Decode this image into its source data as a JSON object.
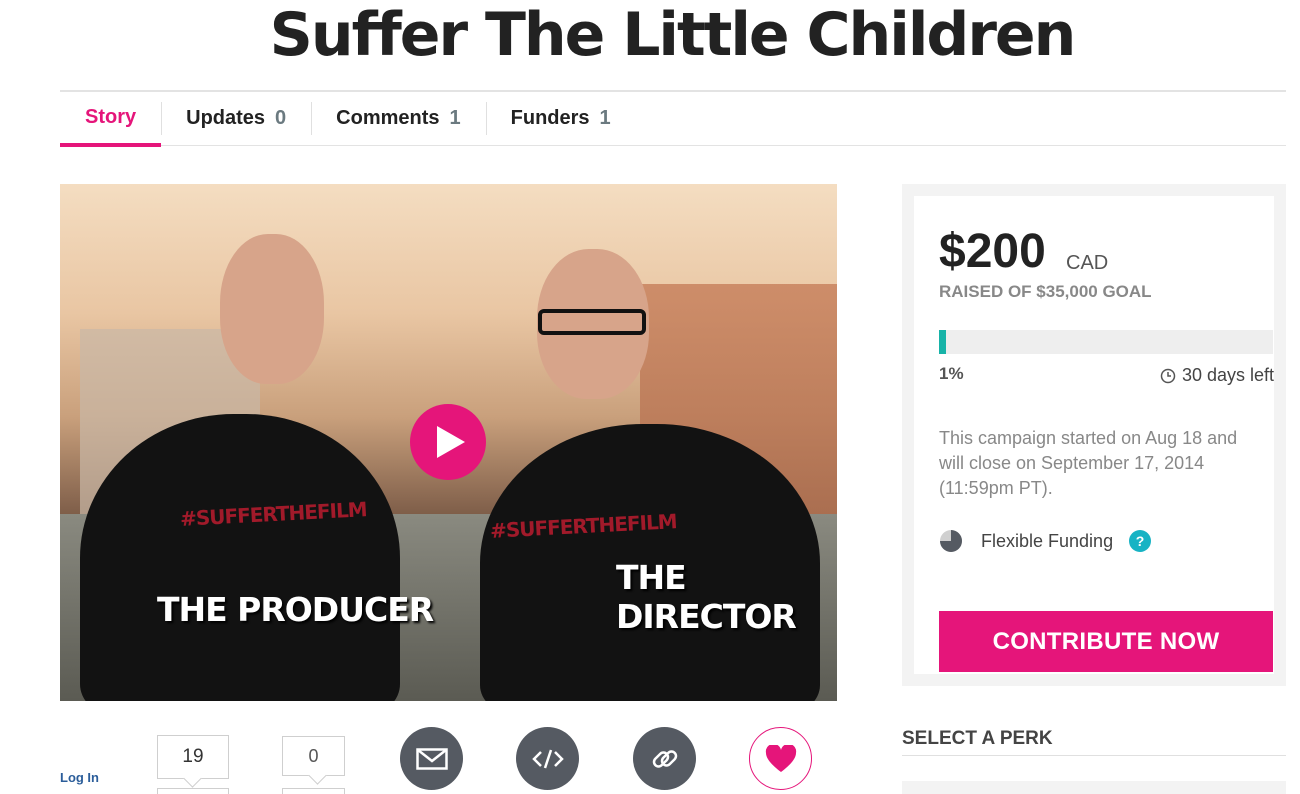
{
  "campaign": {
    "title": "Suffer The Little Children"
  },
  "tabs": [
    {
      "label": "Story",
      "count": ""
    },
    {
      "label": "Updates",
      "count": "0"
    },
    {
      "label": "Comments",
      "count": "1"
    },
    {
      "label": "Funders",
      "count": "1"
    }
  ],
  "video": {
    "shirt_text_left": "#SUFFERTHEFILM",
    "shirt_text_right": "#SUFFERTHEFILM",
    "caption_left": "THE PRODUCER",
    "caption_right": "THE DIRECTOR"
  },
  "funding": {
    "amount": "$200",
    "currency": "CAD",
    "goal_text": "RAISED OF $35,000 GOAL",
    "progress_fraction": 0.01,
    "percent_label": "1%",
    "days_left": "30 days left",
    "description": "This campaign started on Aug 18 and will close on September 17, 2014 (11:59pm PT).",
    "funding_type": "Flexible Funding",
    "help_label": "?",
    "contribute_label": "CONTRIBUTE NOW"
  },
  "perks": {
    "title": "SELECT A PERK"
  },
  "share": {
    "login_label": "Log In",
    "facebook_count": "19",
    "twitter_count": "0"
  },
  "colors": {
    "accent": "#e5157a",
    "progress": "#17b3a8",
    "icon_circle": "#555a62"
  }
}
